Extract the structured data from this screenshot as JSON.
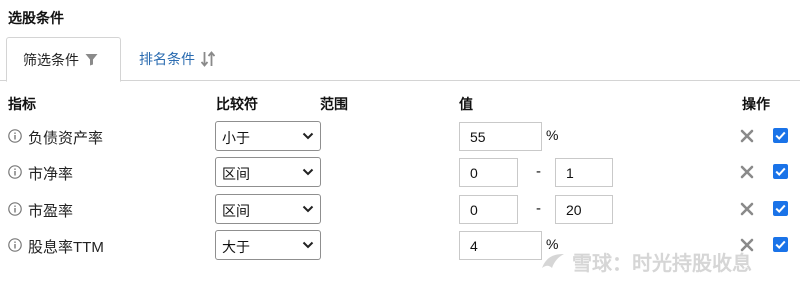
{
  "panel": {
    "title": "选股条件"
  },
  "tabs": [
    {
      "label": "筛选条件",
      "icon": "filter-icon",
      "active": true
    },
    {
      "label": "排名条件",
      "icon": "sort-icon",
      "active": false
    }
  ],
  "headers": {
    "indicator": "指标",
    "comparator": "比较符",
    "range": "范围",
    "value": "值",
    "action": "操作"
  },
  "rows": [
    {
      "label": "负债资产率",
      "comparator": "小于",
      "value": "55",
      "unit": "%"
    },
    {
      "label": "市净率",
      "comparator": "区间",
      "min": "0",
      "separator": "-",
      "max": "1"
    },
    {
      "label": "市盈率",
      "comparator": "区间",
      "min": "0",
      "separator": "-",
      "max": "20"
    },
    {
      "label": "股息率TTM",
      "comparator": "大于",
      "value": "4",
      "unit": "%"
    }
  ],
  "watermark": {
    "text": "雪球：时光持股收息"
  },
  "colors": {
    "checkbox": "#1a73e8",
    "tab_link": "#2a6bb0"
  }
}
